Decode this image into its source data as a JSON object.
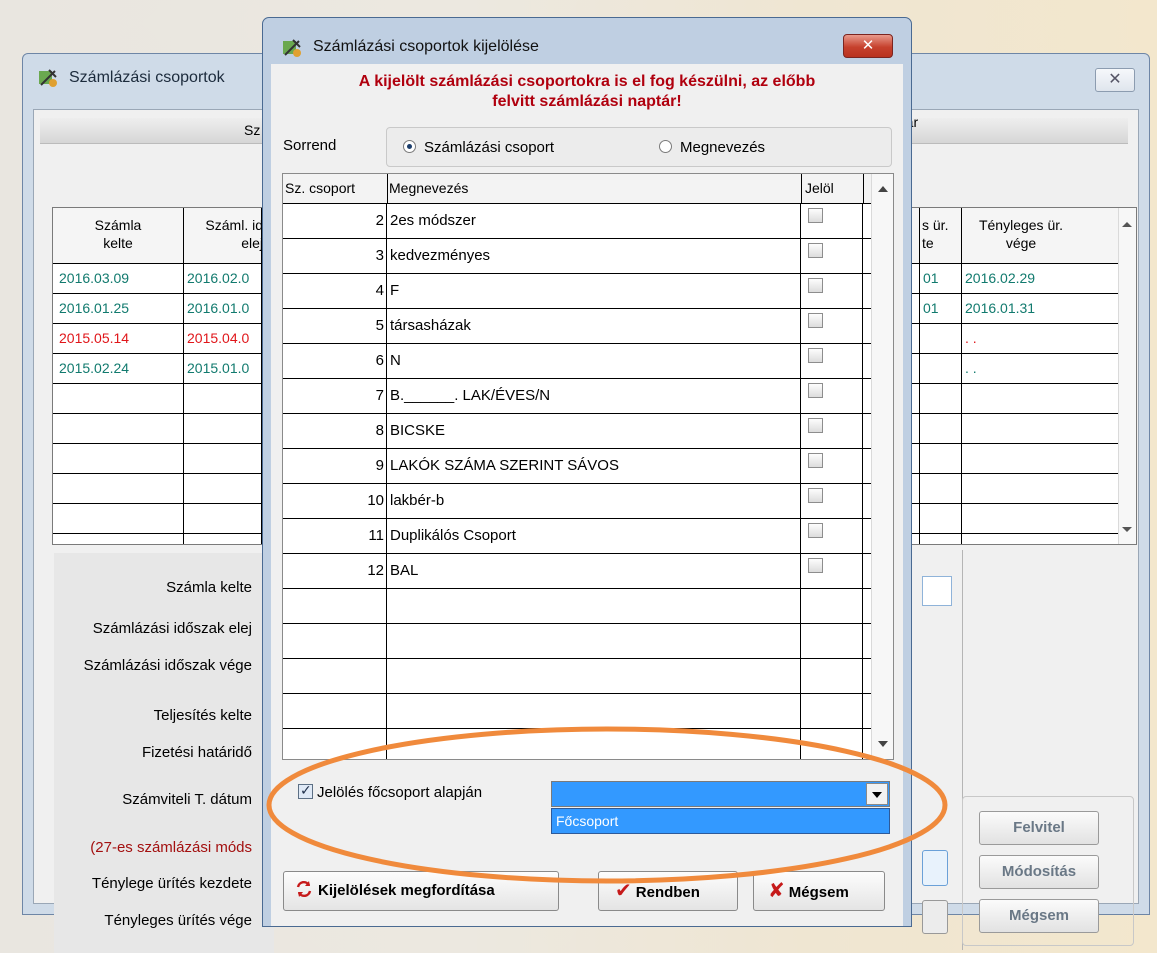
{
  "background_window": {
    "title": "Számlázási csoportok",
    "close": "✕",
    "section_left": "Sz",
    "section_right": "ptár",
    "grid_headers": [
      {
        "l1": "Számla",
        "l2": "kelte"
      },
      {
        "l1": "Száml. id",
        "l2": "elej"
      },
      {
        "l1": "s ür.",
        "l2": "te"
      },
      {
        "l1": "Tényleges ür.",
        "l2": "vége"
      }
    ],
    "grid_rows": [
      {
        "c1": "2016.03.09",
        "c2": "2016.02.0",
        "c3": "01",
        "c4": "2016.02.29",
        "color": "teal"
      },
      {
        "c1": "2016.01.25",
        "c2": "2016.01.0",
        "c3": "01",
        "c4": "2016.01.31",
        "color": "teal"
      },
      {
        "c1": "2015.05.14",
        "c2": "2015.04.0",
        "c3": "",
        "c4": ". .",
        "color": "red"
      },
      {
        "c1": "2015.02.24",
        "c2": "2015.01.0",
        "c3": "",
        "c4": ". .",
        "color": "teal"
      }
    ],
    "form_labels": [
      "Számla kelte",
      "Számlázási időszak elej",
      "Számlázási időszak vége",
      "Teljesítés kelte",
      "Fizetési határidő",
      "Számviteli T. dátum",
      "(27-es számlázási móds",
      "Ténylege ürítés kezdete",
      "Tényleges ürítés vége"
    ],
    "buttons": {
      "felvitel": "Felvitel",
      "modositas": "Módosítás",
      "megsem": "Mégsem"
    }
  },
  "dialog": {
    "title": "Számlázási csoportok kijelölése",
    "close": "✕",
    "warning_line1": "A kijelölt számlázási csoportokra is el fog készülni, az előbb",
    "warning_line2": "felvitt számlázási naptár!",
    "sort_label": "Sorrend",
    "radio_group": "Számlázási csoport",
    "radio_name": "Megnevezés",
    "col_group": "Sz. csoport",
    "col_name": "Megnevezés",
    "col_mark": "Jelöl",
    "rows": [
      {
        "num": "2",
        "name": "2es módszer"
      },
      {
        "num": "3",
        "name": "kedvezményes"
      },
      {
        "num": "4",
        "name": "F"
      },
      {
        "num": "5",
        "name": "társasházak"
      },
      {
        "num": "6",
        "name": "N"
      },
      {
        "num": "7",
        "name": "B.______. LAK/ÉVES/N"
      },
      {
        "num": "8",
        "name": "BICSKE"
      },
      {
        "num": "9",
        "name": "LAKÓK SZÁMA SZERINT SÁVOS"
      },
      {
        "num": "10",
        "name": "lakbér-b"
      },
      {
        "num": "11",
        "name": "Duplikálós Csoport"
      },
      {
        "num": "12",
        "name": "BAL"
      }
    ],
    "main_group_check": "Jelölés főcsoport alapján",
    "dropdown_option": "Főcsoport",
    "btn_invert": "Kijelölések megfordítása",
    "btn_ok": "Rendben",
    "btn_cancel": "Mégsem"
  },
  "colors": {
    "highlight": "#3399ff",
    "warning": "#b0000e",
    "annotation": "#f08a3c"
  }
}
